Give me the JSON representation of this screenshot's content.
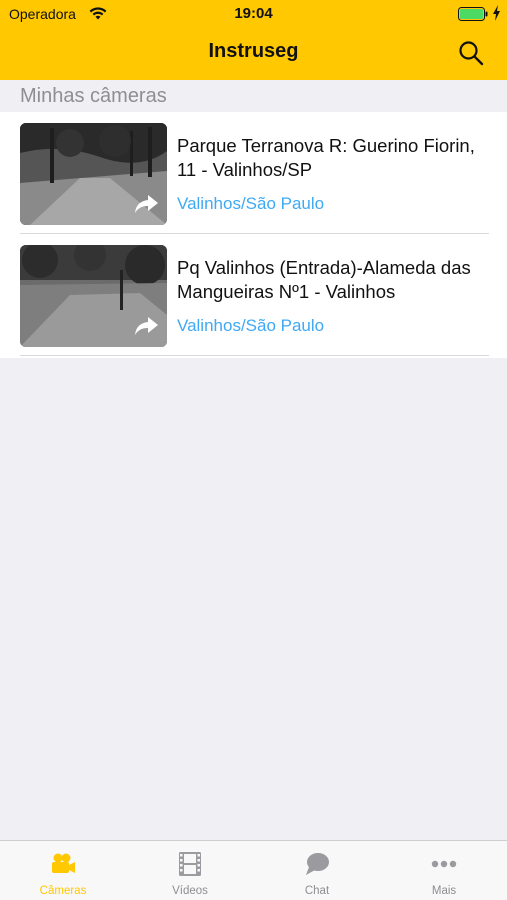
{
  "status_bar": {
    "carrier": "Operadora",
    "time": "19:04",
    "wifi_icon": "wifi-icon",
    "battery_icon": "battery-charging-icon"
  },
  "nav": {
    "title": "Instruseg",
    "search_icon": "search-icon"
  },
  "section": {
    "title": "Minhas câmeras"
  },
  "cameras": [
    {
      "title": "Parque Terranova R: Guerino Fiorin, 11 - Valinhos/SP",
      "location": "Valinhos/São Paulo",
      "share_icon": "share-icon"
    },
    {
      "title": "Pq Valinhos (Entrada)-Alameda das Mangueiras Nº1 - Valinhos",
      "location": "Valinhos/São Paulo",
      "share_icon": "share-icon"
    }
  ],
  "tabs": [
    {
      "label": "Câmeras",
      "icon": "video-camera-icon",
      "active": true
    },
    {
      "label": "Vídeos",
      "icon": "film-icon",
      "active": false
    },
    {
      "label": "Chat",
      "icon": "chat-bubble-icon",
      "active": false
    },
    {
      "label": "Mais",
      "icon": "more-dots-icon",
      "active": false
    }
  ],
  "colors": {
    "accent": "#ffc800",
    "link": "#3fa9f5",
    "inactive": "#8e8e93",
    "background": "#efeff4"
  }
}
